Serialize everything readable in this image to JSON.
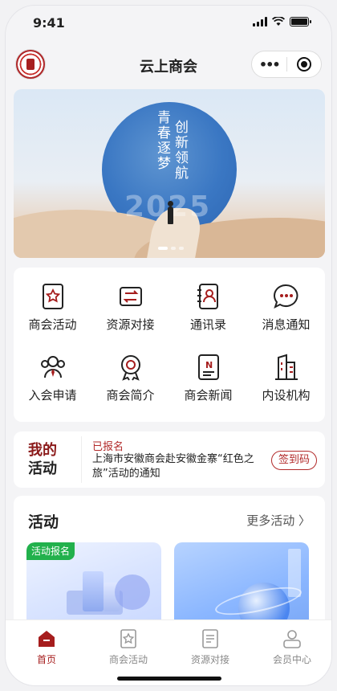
{
  "status": {
    "time": "9:41"
  },
  "header": {
    "title": "云上商会"
  },
  "banner": {
    "line1": "青春逐梦",
    "line2": "创新领航",
    "year": "2025"
  },
  "grid": [
    {
      "label": "商会活动",
      "icon": "star-document-icon"
    },
    {
      "label": "资源对接",
      "icon": "exchange-icon"
    },
    {
      "label": "通讯录",
      "icon": "contacts-book-icon"
    },
    {
      "label": "消息通知",
      "icon": "chat-bubble-icon"
    },
    {
      "label": "入会申请",
      "icon": "member-apply-icon"
    },
    {
      "label": "商会简介",
      "icon": "medal-badge-icon"
    },
    {
      "label": "商会新闻",
      "icon": "news-document-icon"
    },
    {
      "label": "内设机构",
      "icon": "buildings-icon"
    }
  ],
  "my_activity": {
    "label_line1": "我的",
    "label_line2": "活动",
    "status": "已报名",
    "text": "上海市安徽商会赴安徽金寨“红色之旅”活动的通知",
    "code_button": "签到码"
  },
  "activities": {
    "title": "活动",
    "more": "更多活动 〉",
    "badge": "活动报名"
  },
  "tabbar": [
    {
      "label": "首页",
      "icon": "home-icon",
      "active": true
    },
    {
      "label": "商会活动",
      "icon": "activity-star-icon",
      "active": false
    },
    {
      "label": "资源对接",
      "icon": "resource-doc-icon",
      "active": false
    },
    {
      "label": "会员中心",
      "icon": "member-user-icon",
      "active": false
    }
  ],
  "colors": {
    "accent": "#a61d1d",
    "badge_green": "#22b14c"
  }
}
